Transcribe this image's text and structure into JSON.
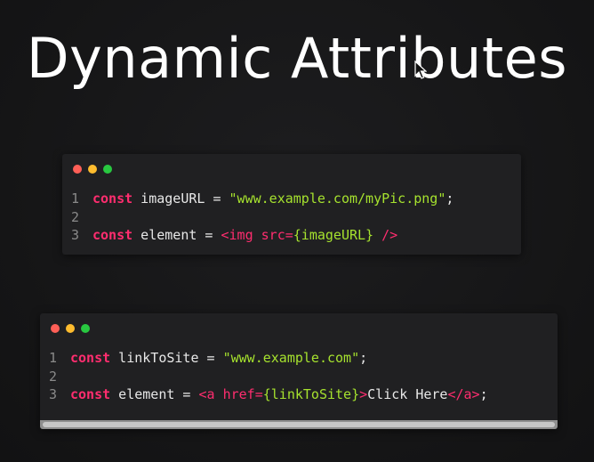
{
  "title": "Dynamic Attributes",
  "colors": {
    "background": "#151516",
    "window": "#202022",
    "keyword": "#ff2d6f",
    "string": "#a6e22e",
    "line_number": "#8a8a8a",
    "dot_red": "#ff5f57",
    "dot_yellow": "#febc2e",
    "dot_green": "#28c840"
  },
  "snippet1": {
    "line_numbers": [
      "1",
      "2",
      "3"
    ],
    "line1": {
      "kw": "const",
      "ident": " imageURL = ",
      "str": "\"www.example.com/myPic.png\"",
      "end": ";"
    },
    "line3": {
      "kw": "const",
      "ident": " element = ",
      "tag_open": "<img src=",
      "expr": "{imageURL}",
      "tag_close": " />"
    }
  },
  "snippet2": {
    "line_numbers": [
      "1",
      "2",
      "3"
    ],
    "line1": {
      "kw": "const",
      "ident": " linkToSite = ",
      "str": "\"www.example.com\"",
      "end": ";"
    },
    "line3": {
      "kw": "const",
      "ident": " element = ",
      "tag_open": "<a href=",
      "expr": "{linkToSite}",
      "tag_gt": ">",
      "text": "Click Here",
      "tag_end": "</a>",
      "end": ";"
    }
  }
}
